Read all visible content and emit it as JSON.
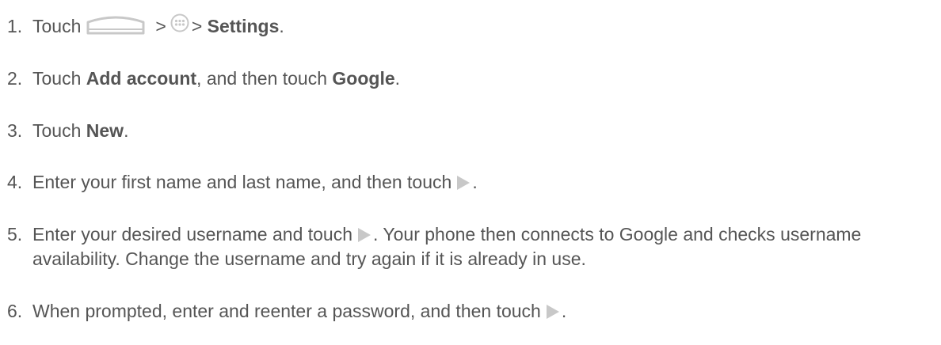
{
  "steps": [
    {
      "number": "1.",
      "parts": [
        "Touch",
        ">",
        ">",
        "Settings",
        "."
      ],
      "icons": [
        "home-icon",
        "apps-icon"
      ]
    },
    {
      "number": "2.",
      "parts": [
        "Touch ",
        "Add account",
        ", and then touch ",
        "Google",
        "."
      ]
    },
    {
      "number": "3.",
      "parts": [
        "Touch ",
        "New",
        "."
      ]
    },
    {
      "number": "4.",
      "parts": [
        "Enter your first name and last name, and then touch",
        "."
      ],
      "icons": [
        "next-arrow-icon"
      ]
    },
    {
      "number": "5.",
      "parts": [
        "Enter your desired username and touch",
        ". Your phone then connects to Google and checks username availability. Change the username and try again if it is already in use."
      ],
      "icons": [
        "next-arrow-icon"
      ]
    },
    {
      "number": "6.",
      "parts": [
        "When prompted, enter and reenter a password, and then touch",
        "."
      ],
      "icons": [
        "next-arrow-icon"
      ]
    }
  ],
  "colors": {
    "text": "#555555",
    "icon": "#c8c8c8"
  }
}
